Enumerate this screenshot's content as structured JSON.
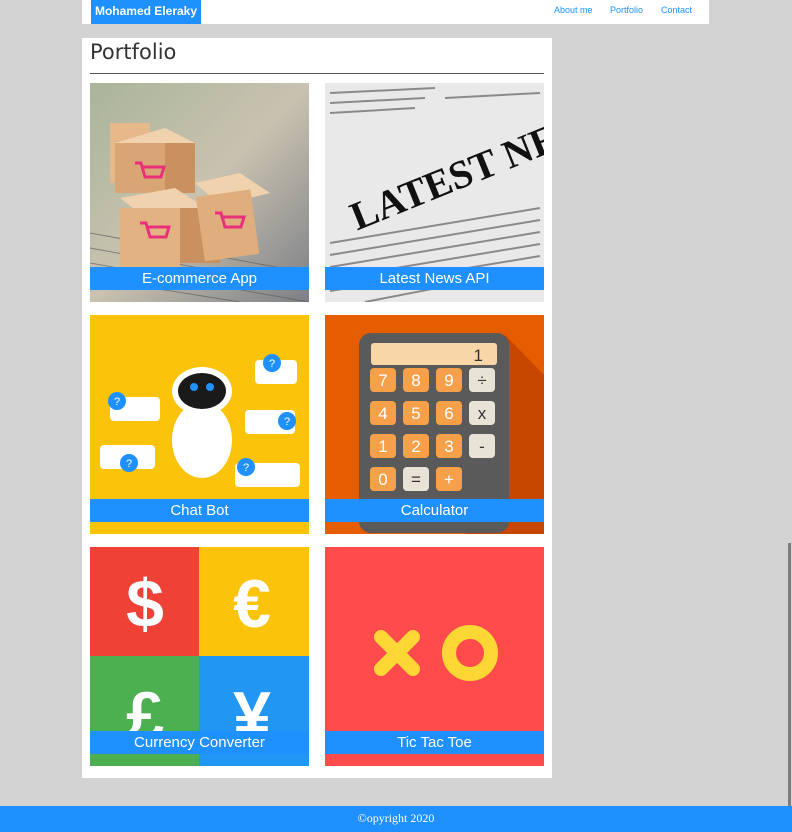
{
  "header": {
    "brand": "Mohamed Eleraky",
    "nav": {
      "about": "About me",
      "portfolio": "Portfolio",
      "contact": "Contact"
    }
  },
  "main": {
    "title": "Portfolio",
    "projects": [
      {
        "label": "E-commerce App"
      },
      {
        "label": "Latest News API"
      },
      {
        "label": "Chat Bot"
      },
      {
        "label": "Calculator"
      },
      {
        "label": "Currency Converter"
      },
      {
        "label": "Tic Tac Toe"
      }
    ],
    "art": {
      "news_banner": "LATEST NEWS",
      "calc_display": "1",
      "calc_keys": [
        "7",
        "8",
        "9",
        "÷",
        "4",
        "5",
        "6",
        "x",
        "1",
        "2",
        "3",
        "-",
        "0",
        "=",
        "+"
      ],
      "currency_symbols": [
        "$",
        "€",
        "£",
        "¥"
      ],
      "chat_marks": "?"
    }
  },
  "footer": {
    "text": "©opyright 2020"
  },
  "colors": {
    "accent": "#1e90ff",
    "background": "#d3d3d3"
  }
}
